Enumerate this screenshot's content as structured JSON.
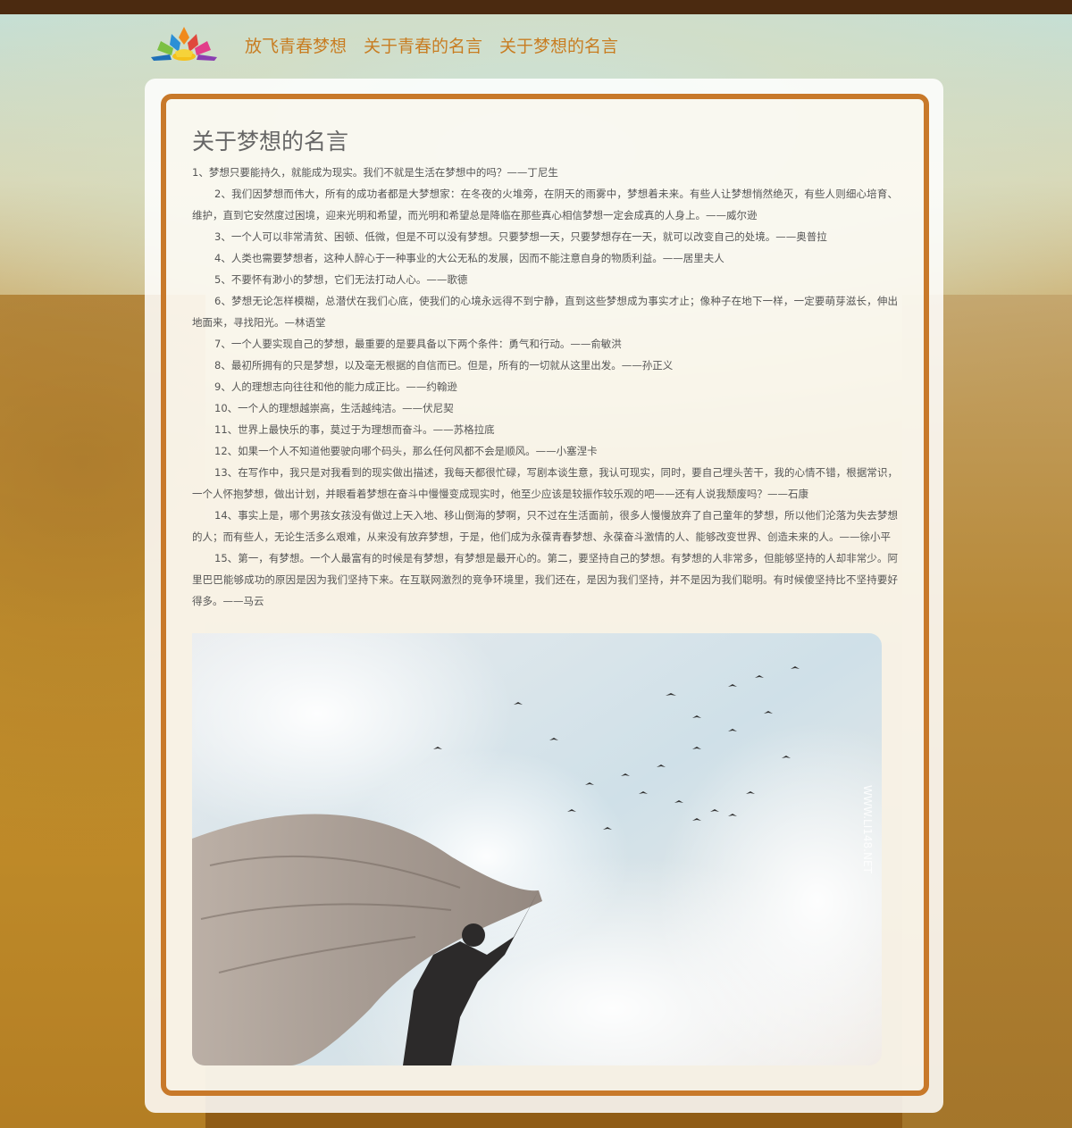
{
  "nav": {
    "links": [
      "放飞青春梦想",
      "关于青春的名言",
      "关于梦想的名言"
    ]
  },
  "article": {
    "title": "关于梦想的名言",
    "paragraphs": [
      "1、梦想只要能持久，就能成为现实。我们不就是生活在梦想中的吗？——丁尼生",
      "2、我们因梦想而伟大，所有的成功者都是大梦想家：在冬夜的火堆旁，在阴天的雨雾中，梦想着未来。有些人让梦想悄然绝灭，有些人则细心培育、维护，直到它安然度过困境，迎来光明和希望，而光明和希望总是降临在那些真心相信梦想一定会成真的人身上。——威尔逊",
      "3、一个人可以非常清贫、困顿、低微，但是不可以没有梦想。只要梦想一天，只要梦想存在一天，就可以改变自己的处境。——奥普拉",
      "4、人类也需要梦想者，这种人醉心于一种事业的大公无私的发展，因而不能注意自身的物质利益。——居里夫人",
      "5、不要怀有渺小的梦想，它们无法打动人心。——歌德",
      "6、梦想无论怎样模糊，总潜伏在我们心底，使我们的心境永远得不到宁静，直到这些梦想成为事实才止；像种子在地下一样，一定要萌芽滋长，伸出地面来，寻找阳光。—林语堂",
      "7、一个人要实现自己的梦想，最重要的是要具备以下两个条件：勇气和行动。——俞敏洪",
      "8、最初所拥有的只是梦想，以及毫无根据的自信而已。但是，所有的一切就从这里出发。——孙正义",
      "9、人的理想志向往往和他的能力成正比。——约翰逊",
      "10、一个人的理想越崇高，生活越纯洁。——伏尼契",
      "11、世界上最快乐的事，莫过于为理想而奋斗。——苏格拉底",
      "12、如果一个人不知道他要驶向哪个码头，那么任何风都不会是顺风。——小塞涅卡",
      "13、在写作中，我只是对我看到的现实做出描述，我每天都很忙碌，写剧本谈生意，我认可现实，同时，要自己埋头苦干，我的心情不错，根据常识，一个人怀抱梦想，做出计划，并眼看着梦想在奋斗中慢慢变成现实时，他至少应该是较振作较乐观的吧——还有人说我颓废吗？——石康",
      "14、事实上是，哪个男孩女孩没有做过上天入地、移山倒海的梦啊，只不过在生活面前，很多人慢慢放弃了自己童年的梦想，所以他们沦落为失去梦想的人；而有些人，无论生活多么艰难，从来没有放弃梦想，于是，他们成为永葆青春梦想、永葆奋斗激情的人、能够改变世界、创造未来的人。——徐小平",
      "15、第一，有梦想。一个人最富有的时候是有梦想，有梦想是最开心的。第二，要坚持自己的梦想。有梦想的人非常多，但能够坚持的人却非常少。阿里巴巴能够成功的原因是因为我们坚持下来。在互联网激烈的竞争环境里，我们还在，是因为我们坚持，并不是因为我们聪明。有时候傻坚持比不坚持要好得多。——马云"
    ],
    "image_watermark": "WWW.LI148.NET"
  },
  "colors": {
    "topbar": "#4b2a10",
    "nav_link": "#c87d22",
    "frame_border": "#c8792a",
    "text": "#555555"
  }
}
